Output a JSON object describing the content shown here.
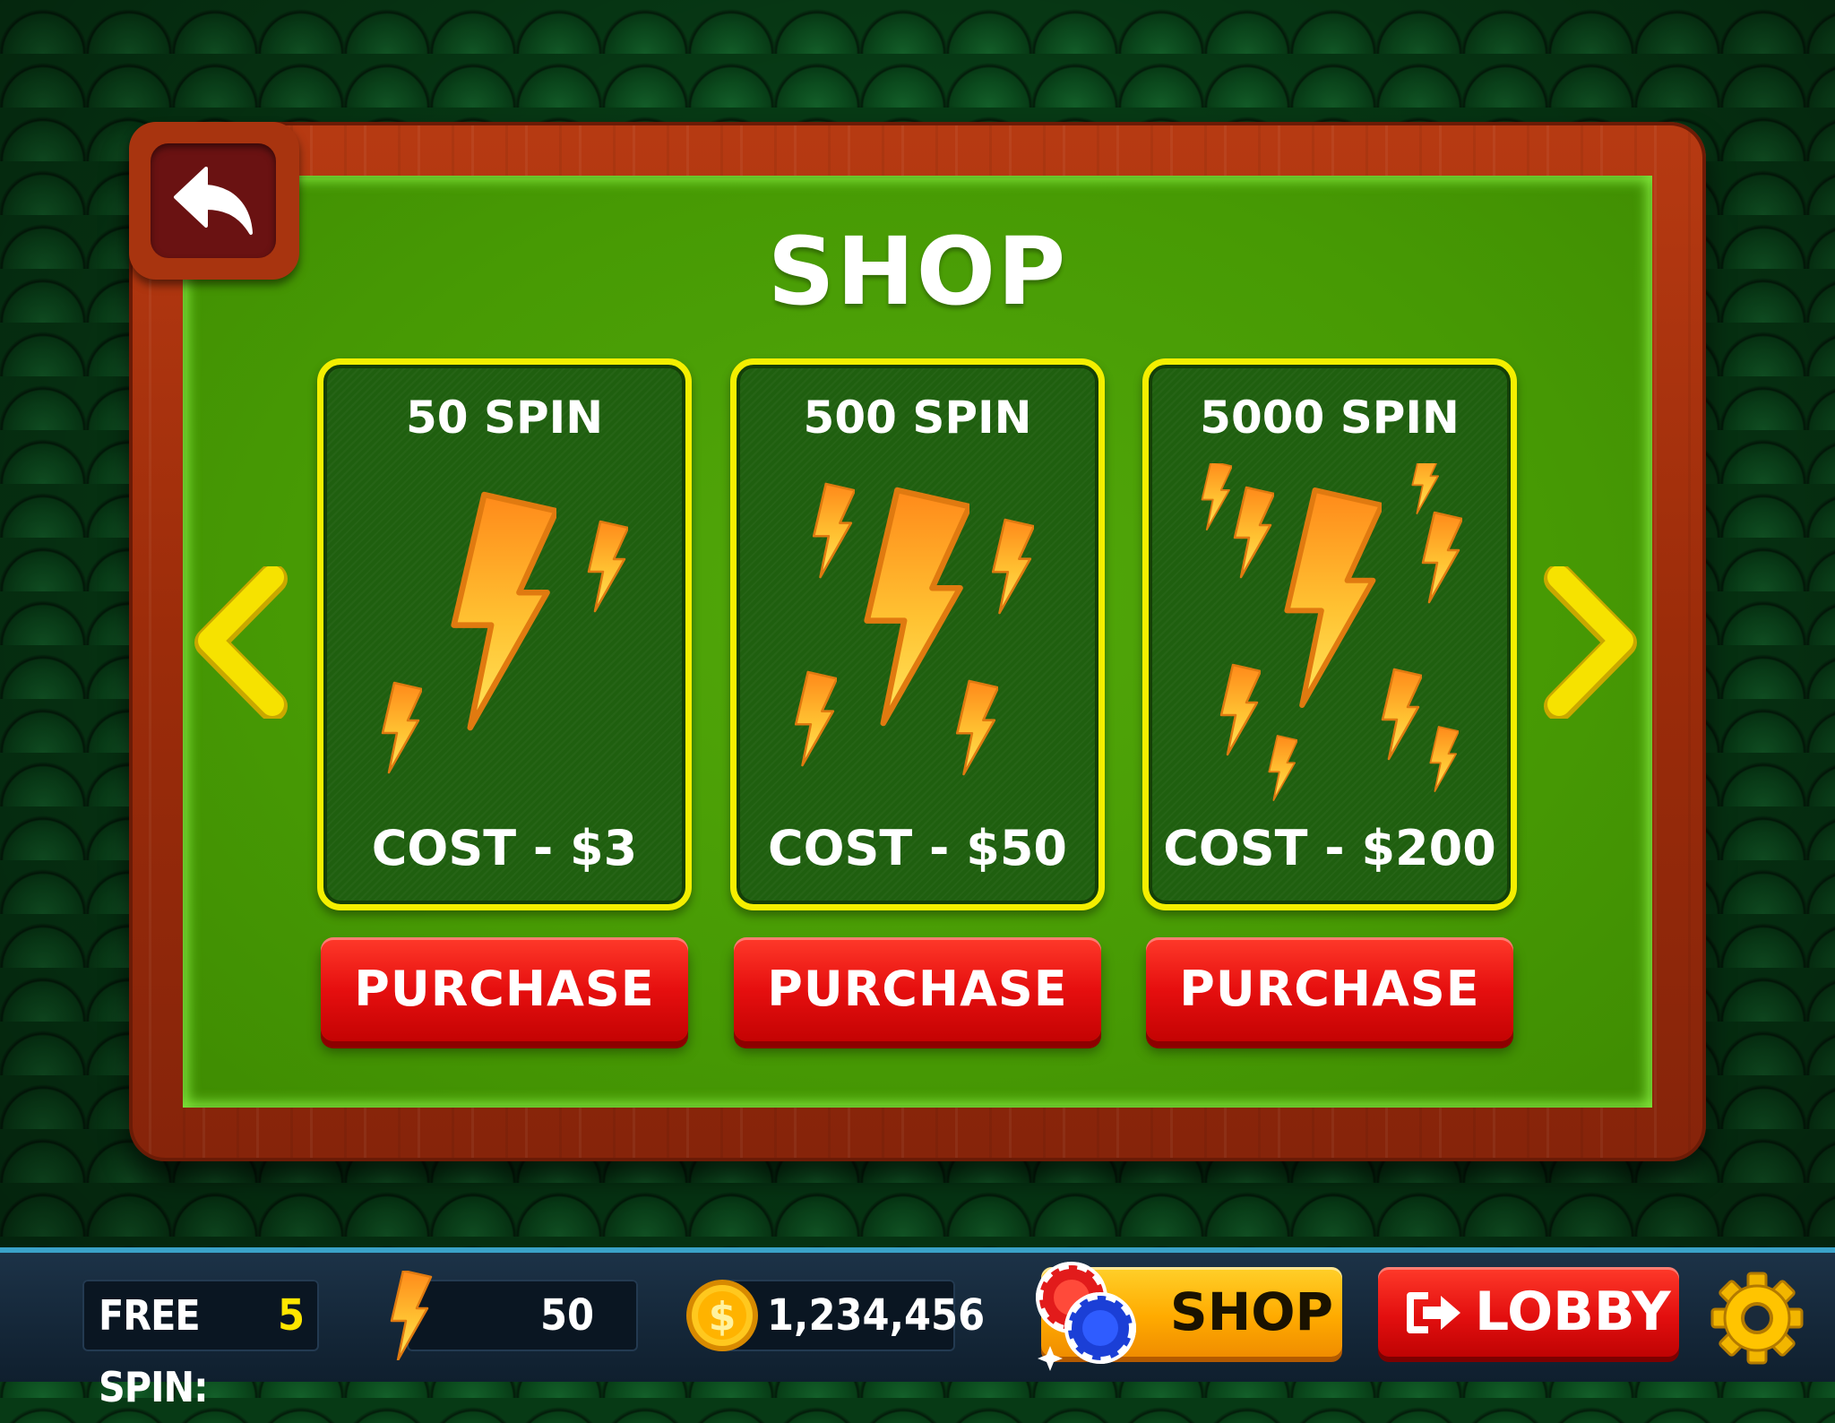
{
  "title": "SHOP",
  "cards": [
    {
      "title": "50 SPIN",
      "cost": "COST - $3",
      "button": "PURCHASE"
    },
    {
      "title": "500 SPIN",
      "cost": "COST - $50",
      "button": "PURCHASE"
    },
    {
      "title": "5000 SPIN",
      "cost": "COST - $200",
      "button": "PURCHASE"
    }
  ],
  "hud": {
    "free_spin_label": "FREE SPIN:",
    "free_spin_value": "5",
    "energy_value": "50",
    "coins_value": "1,234,456",
    "shop_label": "SHOP",
    "lobby_label": "LOBBY"
  },
  "icons": {
    "back": "back-arrow-icon",
    "prev": "chevron-left-icon",
    "next": "chevron-right-icon",
    "bolt": "lightning-bolt-icon",
    "coin": "dollar-coin-icon",
    "chips": "casino-chips-icon",
    "exit": "exit-icon",
    "settings": "gear-icon"
  },
  "colors": {
    "felt": "#479a04",
    "wood": "#9c2c0a",
    "card_border": "#f4ef00",
    "button_red": "#e60f0f",
    "arrow_yellow": "#f4e000",
    "shop_orange": "#ffab00"
  }
}
